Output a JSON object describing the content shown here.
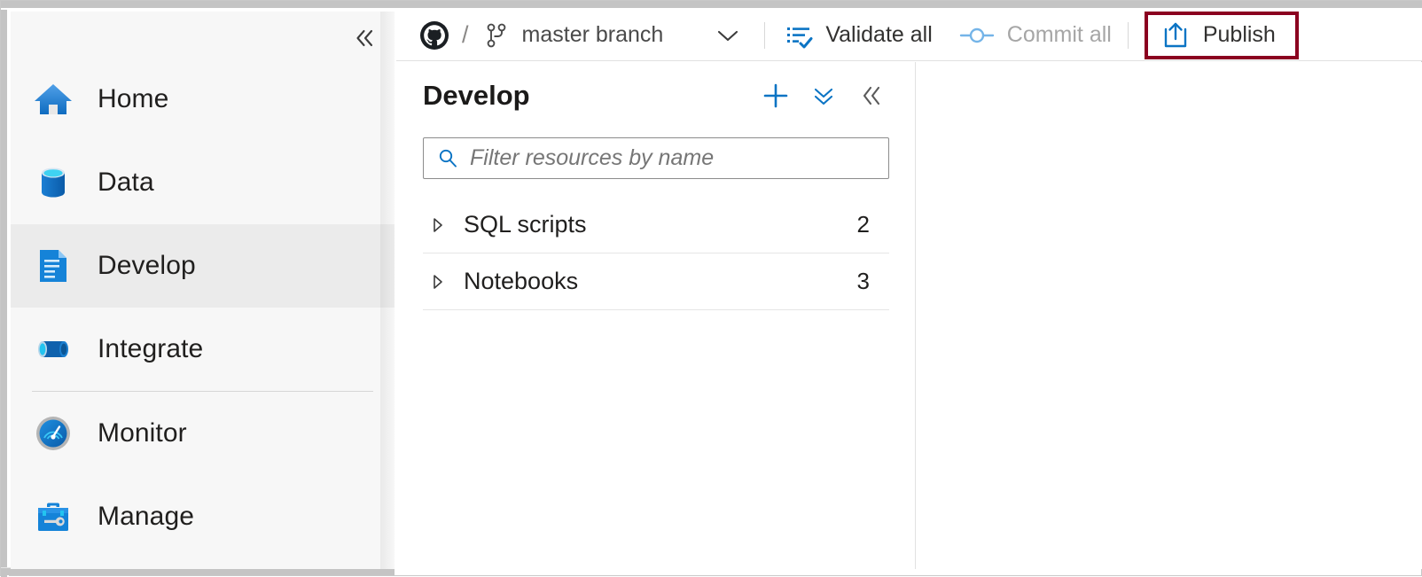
{
  "toolbar": {
    "repo_icon": "github-octocat-icon",
    "separator": "/",
    "branch_icon": "git-branch-icon",
    "branch_name": "master branch",
    "branch_dropdown_icon": "chevron-down-icon",
    "validate_icon": "validate-checklist-icon",
    "validate_label": "Validate all",
    "commit_icon": "git-commit-icon",
    "commit_label": "Commit all",
    "commit_disabled": true,
    "publish_icon": "publish-upload-icon",
    "publish_label": "Publish",
    "publish_highlight_color": "#8b0020",
    "accent_color": "#0078d4"
  },
  "sidebar": {
    "collapse_icon": "double-chevron-left-icon",
    "items": [
      {
        "label": "Home",
        "icon": "home-icon",
        "selected": false
      },
      {
        "label": "Data",
        "icon": "database-icon",
        "selected": false
      },
      {
        "label": "Develop",
        "icon": "develop-document-icon",
        "selected": true
      },
      {
        "label": "Integrate",
        "icon": "integrate-pipeline-icon",
        "selected": false
      },
      {
        "label": "Monitor",
        "icon": "monitor-gauge-icon",
        "selected": false
      },
      {
        "label": "Manage",
        "icon": "manage-toolbox-icon",
        "selected": false
      }
    ]
  },
  "develop_panel": {
    "title": "Develop",
    "add_icon": "plus-icon",
    "collapse_all_icon": "double-chevron-down-icon",
    "hide_panel_icon": "double-chevron-left-icon",
    "filter": {
      "icon": "search-icon",
      "value": "",
      "placeholder": "Filter resources by name"
    },
    "tree": [
      {
        "label": "SQL scripts",
        "count": "2",
        "expander": "triangle-right-icon"
      },
      {
        "label": "Notebooks",
        "count": "3",
        "expander": "triangle-right-icon"
      }
    ]
  }
}
